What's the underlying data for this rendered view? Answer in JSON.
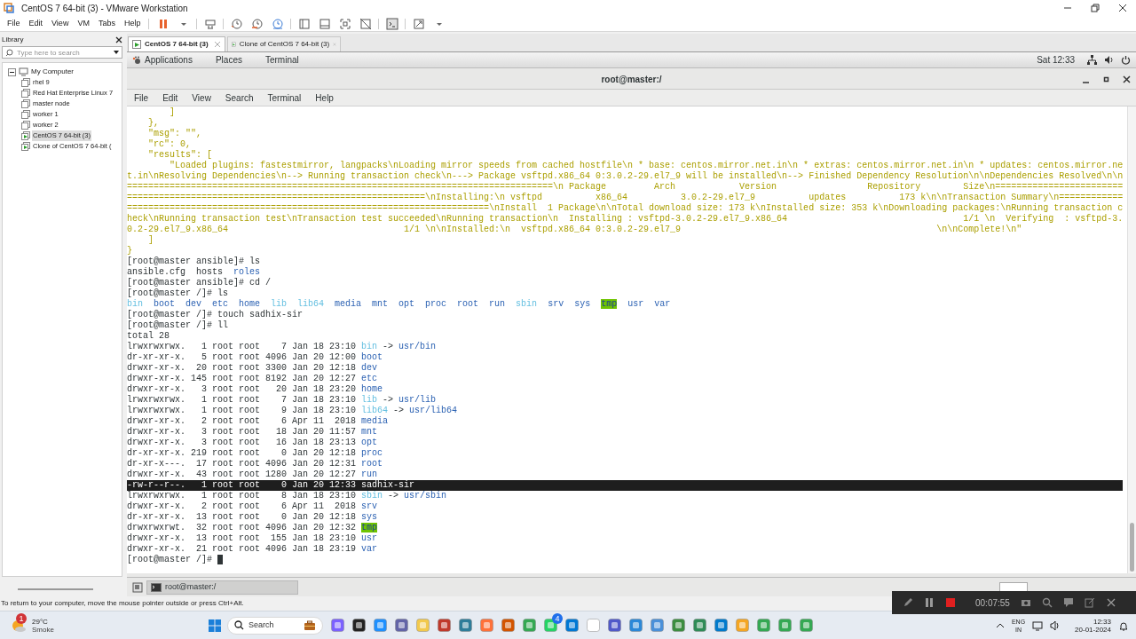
{
  "window": {
    "title": "CentOS 7 64-bit (3) - VMware Workstation"
  },
  "menu": [
    "File",
    "Edit",
    "View",
    "VM",
    "Tabs",
    "Help"
  ],
  "library": {
    "title": "Library",
    "search_placeholder": "Type here to search",
    "tree": [
      {
        "label": "My Computer",
        "expanded": true,
        "children": [
          {
            "label": "rhel 9",
            "running": false,
            "selected": false
          },
          {
            "label": "Red Hat Enterprise Linux 7",
            "running": false,
            "selected": false
          },
          {
            "label": "master node",
            "running": false,
            "selected": false
          },
          {
            "label": "worker 1",
            "running": false,
            "selected": false
          },
          {
            "label": "worker 2",
            "running": false,
            "selected": false
          },
          {
            "label": "CentOS 7 64-bit (3)",
            "running": true,
            "selected": true
          },
          {
            "label": "Clone of CentOS 7 64-bit (",
            "running": true,
            "selected": false
          }
        ]
      }
    ]
  },
  "vm_tabs": [
    {
      "label": "CentOS 7 64-bit (3)",
      "selected": true
    },
    {
      "label": "Clone of CentOS 7 64-bit (3)",
      "selected": false
    }
  ],
  "gnome_bar": {
    "menus": [
      "Applications",
      "Places",
      "Terminal"
    ],
    "clock": "Sat 12:33"
  },
  "terminal": {
    "title": "root@master:/",
    "menu": [
      "File",
      "Edit",
      "View",
      "Search",
      "Terminal",
      "Help"
    ],
    "cursor": true,
    "lines": [
      {
        "highlighted": false,
        "segments": [
          {
            "text": "        ]",
            "kind": "output"
          }
        ]
      },
      {
        "highlighted": false,
        "segments": [
          {
            "text": "    },",
            "kind": "output"
          }
        ]
      },
      {
        "highlighted": false,
        "segments": [
          {
            "text": "    \"msg\": \"\",",
            "kind": "output"
          }
        ]
      },
      {
        "highlighted": false,
        "segments": [
          {
            "text": "    \"rc\": 0,",
            "kind": "output"
          }
        ]
      },
      {
        "highlighted": false,
        "segments": [
          {
            "text": "    \"results\": [",
            "kind": "output"
          }
        ]
      },
      {
        "highlighted": false,
        "segments": [
          {
            "text": "        \"Loaded plugins: fastestmirror, langpacks\\nLoading mirror speeds from cached hostfile\\n * base: centos.mirror.net.in\\n * extras: centos.mirror.net.in\\n * updates: centos.mirror.ne",
            "kind": "output"
          }
        ]
      },
      {
        "highlighted": false,
        "segments": [
          {
            "text": "t.in\\nResolving Dependencies\\n--> Running transaction check\\n---> Package vsftpd.x86_64 0:3.0.2-29.el7_9 will be installed\\n--> Finished Dependency Resolution\\n\\nDependencies Resolved\\n\\n",
            "kind": "output"
          }
        ]
      },
      {
        "highlighted": false,
        "segments": [
          {
            "text": "================================================================================\\n Package         Arch            Version                 Repository        Size\\n========================",
            "kind": "output"
          }
        ]
      },
      {
        "highlighted": false,
        "segments": [
          {
            "text": "========================================================\\nInstalling:\\n vsftpd          x86_64          3.0.2-29.el7_9          updates          173 k\\n\\nTransaction Summary\\n============",
            "kind": "output"
          }
        ]
      },
      {
        "highlighted": false,
        "segments": [
          {
            "text": "====================================================================\\nInstall  1 Package\\n\\nTotal download size: 173 k\\nInstalled size: 353 k\\nDownloading packages:\\nRunning transaction c",
            "kind": "output"
          }
        ]
      },
      {
        "highlighted": false,
        "segments": [
          {
            "text": "heck\\nRunning transaction test\\nTransaction test succeeded\\nRunning transaction\\n  Installing : vsftpd-3.0.2-29.el7_9.x86_64                                 1/1 \\n  Verifying  : vsftpd-3.",
            "kind": "output"
          }
        ]
      },
      {
        "highlighted": false,
        "segments": [
          {
            "text": "0.2-29.el7_9.x86_64                                 1/1 \\n\\nInstalled:\\n  vsftpd.x86_64 0:3.0.2-29.el7_9                                                \\n\\nComplete!\\n\"",
            "kind": "output"
          }
        ]
      },
      {
        "highlighted": false,
        "segments": [
          {
            "text": "    ]",
            "kind": "output"
          }
        ]
      },
      {
        "highlighted": false,
        "segments": [
          {
            "text": "}",
            "kind": "output"
          }
        ]
      },
      {
        "highlighted": false,
        "segments": [
          {
            "text": "[root@master ansible]# ls",
            "kind": "plain"
          }
        ]
      },
      {
        "highlighted": false,
        "segments": [
          {
            "text": "ansible.cfg  hosts  ",
            "kind": "plain"
          },
          {
            "text": "roles",
            "kind": "dir"
          }
        ]
      },
      {
        "highlighted": false,
        "segments": [
          {
            "text": "[root@master ansible]# cd /",
            "kind": "plain"
          }
        ]
      },
      {
        "highlighted": false,
        "segments": [
          {
            "text": "[root@master /]# ls",
            "kind": "plain"
          }
        ]
      },
      {
        "highlighted": false,
        "segments": [
          {
            "text": "bin",
            "kind": "link"
          },
          {
            "text": "  boot  dev  etc  home  ",
            "kind": "dir"
          },
          {
            "text": "lib  lib64",
            "kind": "link"
          },
          {
            "text": "  media  mnt  opt  proc  root  run  ",
            "kind": "dir"
          },
          {
            "text": "sbin",
            "kind": "link"
          },
          {
            "text": "  srv  sys  ",
            "kind": "dir"
          },
          {
            "text": "tmp",
            "kind": "sticky"
          },
          {
            "text": "  usr  var",
            "kind": "dir"
          }
        ]
      },
      {
        "highlighted": false,
        "segments": [
          {
            "text": "[root@master /]# touch sadhix-sir",
            "kind": "plain"
          }
        ]
      },
      {
        "highlighted": false,
        "segments": [
          {
            "text": "[root@master /]# ll",
            "kind": "plain"
          }
        ]
      },
      {
        "highlighted": false,
        "segments": [
          {
            "text": "total 28",
            "kind": "plain"
          }
        ]
      },
      {
        "highlighted": false,
        "segments": [
          {
            "text": "lrwxrwxrwx.   1 root root    7 Jan 18 23:10 ",
            "kind": "plain"
          },
          {
            "text": "bin",
            "kind": "link"
          },
          {
            "text": " -> ",
            "kind": "plain"
          },
          {
            "text": "usr/bin",
            "kind": "dir"
          }
        ]
      },
      {
        "highlighted": false,
        "segments": [
          {
            "text": "dr-xr-xr-x.   5 root root 4096 Jan 20 12:00 ",
            "kind": "plain"
          },
          {
            "text": "boot",
            "kind": "dir"
          }
        ]
      },
      {
        "highlighted": false,
        "segments": [
          {
            "text": "drwxr-xr-x.  20 root root 3300 Jan 20 12:18 ",
            "kind": "plain"
          },
          {
            "text": "dev",
            "kind": "dir"
          }
        ]
      },
      {
        "highlighted": false,
        "segments": [
          {
            "text": "drwxr-xr-x. 145 root root 8192 Jan 20 12:27 ",
            "kind": "plain"
          },
          {
            "text": "etc",
            "kind": "dir"
          }
        ]
      },
      {
        "highlighted": false,
        "segments": [
          {
            "text": "drwxr-xr-x.   3 root root   20 Jan 18 23:20 ",
            "kind": "plain"
          },
          {
            "text": "home",
            "kind": "dir"
          }
        ]
      },
      {
        "highlighted": false,
        "segments": [
          {
            "text": "lrwxrwxrwx.   1 root root    7 Jan 18 23:10 ",
            "kind": "plain"
          },
          {
            "text": "lib",
            "kind": "link"
          },
          {
            "text": " -> ",
            "kind": "plain"
          },
          {
            "text": "usr/lib",
            "kind": "dir"
          }
        ]
      },
      {
        "highlighted": false,
        "segments": [
          {
            "text": "lrwxrwxrwx.   1 root root    9 Jan 18 23:10 ",
            "kind": "plain"
          },
          {
            "text": "lib64",
            "kind": "link"
          },
          {
            "text": " -> ",
            "kind": "plain"
          },
          {
            "text": "usr/lib64",
            "kind": "dir"
          }
        ]
      },
      {
        "highlighted": false,
        "segments": [
          {
            "text": "drwxr-xr-x.   2 root root    6 Apr 11  2018 ",
            "kind": "plain"
          },
          {
            "text": "media",
            "kind": "dir"
          }
        ]
      },
      {
        "highlighted": false,
        "segments": [
          {
            "text": "drwxr-xr-x.   3 root root   18 Jan 20 11:57 ",
            "kind": "plain"
          },
          {
            "text": "mnt",
            "kind": "dir"
          }
        ]
      },
      {
        "highlighted": false,
        "segments": [
          {
            "text": "drwxr-xr-x.   3 root root   16 Jan 18 23:13 ",
            "kind": "plain"
          },
          {
            "text": "opt",
            "kind": "dir"
          }
        ]
      },
      {
        "highlighted": false,
        "segments": [
          {
            "text": "dr-xr-xr-x. 219 root root    0 Jan 20 12:18 ",
            "kind": "plain"
          },
          {
            "text": "proc",
            "kind": "dir"
          }
        ]
      },
      {
        "highlighted": false,
        "segments": [
          {
            "text": "dr-xr-x---.  17 root root 4096 Jan 20 12:31 ",
            "kind": "plain"
          },
          {
            "text": "root",
            "kind": "dir"
          }
        ]
      },
      {
        "highlighted": false,
        "segments": [
          {
            "text": "drwxr-xr-x.  43 root root 1280 Jan 20 12:27 ",
            "kind": "plain"
          },
          {
            "text": "run",
            "kind": "dir"
          }
        ]
      },
      {
        "highlighted": true,
        "segments": [
          {
            "text": "-rw-r--r--.   1 root root    0 Jan 20 12:33 sadhix-sir",
            "kind": "plain"
          }
        ]
      },
      {
        "highlighted": false,
        "segments": [
          {
            "text": "lrwxrwxrwx.   1 root root    8 Jan 18 23:10 ",
            "kind": "plain"
          },
          {
            "text": "sbin",
            "kind": "link"
          },
          {
            "text": " -> ",
            "kind": "plain"
          },
          {
            "text": "usr/sbin",
            "kind": "dir"
          }
        ]
      },
      {
        "highlighted": false,
        "segments": [
          {
            "text": "drwxr-xr-x.   2 root root    6 Apr 11  2018 ",
            "kind": "plain"
          },
          {
            "text": "srv",
            "kind": "dir"
          }
        ]
      },
      {
        "highlighted": false,
        "segments": [
          {
            "text": "dr-xr-xr-x.  13 root root    0 Jan 20 12:18 ",
            "kind": "plain"
          },
          {
            "text": "sys",
            "kind": "dir"
          }
        ]
      },
      {
        "highlighted": false,
        "segments": [
          {
            "text": "drwxrwxrwt.  32 root root 4096 Jan 20 12:32 ",
            "kind": "plain"
          },
          {
            "text": "tmp",
            "kind": "sticky"
          }
        ]
      },
      {
        "highlighted": false,
        "segments": [
          {
            "text": "drwxr-xr-x.  13 root root  155 Jan 18 23:10 ",
            "kind": "plain"
          },
          {
            "text": "usr",
            "kind": "dir"
          }
        ]
      },
      {
        "highlighted": false,
        "segments": [
          {
            "text": "drwxr-xr-x.  21 root root 4096 Jan 18 23:19 ",
            "kind": "plain"
          },
          {
            "text": "var",
            "kind": "dir"
          }
        ]
      },
      {
        "highlighted": false,
        "segments": [
          {
            "text": "[root@master /]# ",
            "kind": "plain"
          }
        ]
      }
    ]
  },
  "gnome_taskbar": {
    "task": "root@master:/"
  },
  "status_text": "To return to your computer, move the mouse pointer outside or press Ctrl+Alt.",
  "recorder": {
    "time": "00:07:55"
  },
  "taskbar": {
    "weather_badge": "1",
    "temperature": "29°C",
    "weather": "Smoke",
    "search": "Search",
    "app_badge": "4",
    "language": "ENG",
    "region": "IN",
    "time": "12:33",
    "date": "20-01-2024"
  }
}
